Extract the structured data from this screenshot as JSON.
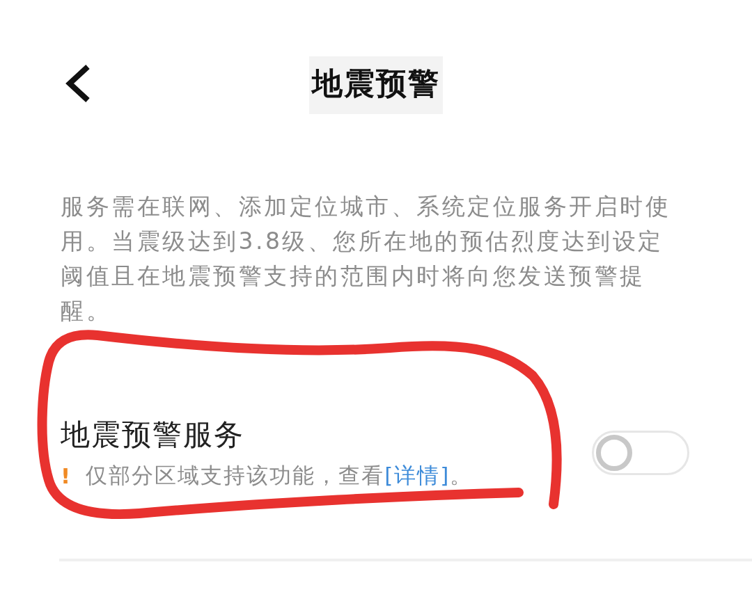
{
  "header": {
    "title": "地震预警"
  },
  "description": "服务需在联网、添加定位城市、系统定位服务开启时使用。当震级达到3.8级、您所在地的预估烈度达到设定阈值且在地震预警支持的范围内时将向您发送预警提醒。",
  "service": {
    "title": "地震预警服务",
    "warning_mark": "!",
    "note": "仅部分区域支持该功能，查看",
    "link": "[详情]",
    "note_end": "。",
    "on": false
  }
}
